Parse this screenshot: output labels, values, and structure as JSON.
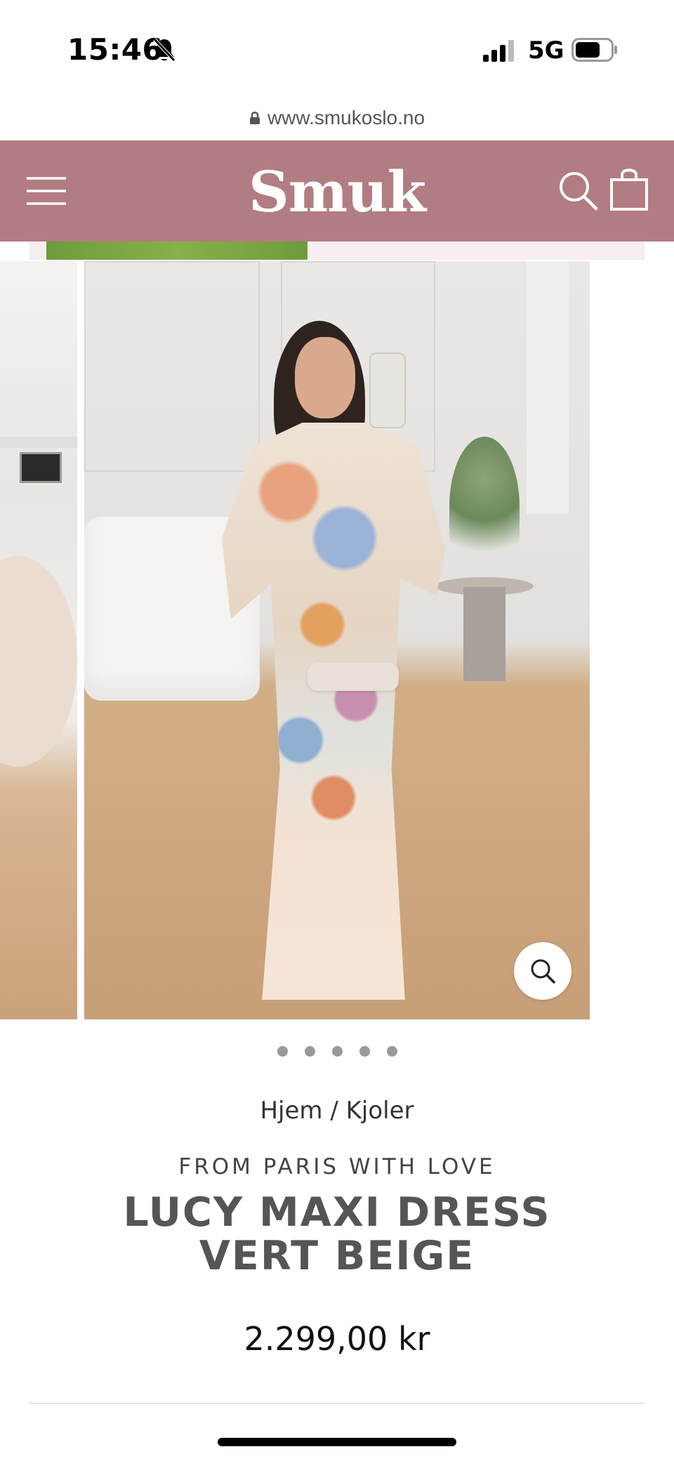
{
  "status_bar": {
    "time": "15:46",
    "network": "5G",
    "icons": [
      "bell-off-icon",
      "signal-icon",
      "battery-icon"
    ]
  },
  "browser": {
    "url": "www.smukoslo.no"
  },
  "header": {
    "logo": "Smuk",
    "background_color": "#b27c83",
    "icons": [
      "menu-icon",
      "search-icon",
      "bag-icon"
    ]
  },
  "gallery": {
    "image_count": 5,
    "zoom_icon": "zoom-icon"
  },
  "product": {
    "breadcrumb": "Hjem / Kjoler",
    "brand": "FROM PARIS WITH LOVE",
    "title": "LUCY MAXI DRESS VERT BEIGE",
    "price": "2.299,00 kr"
  }
}
